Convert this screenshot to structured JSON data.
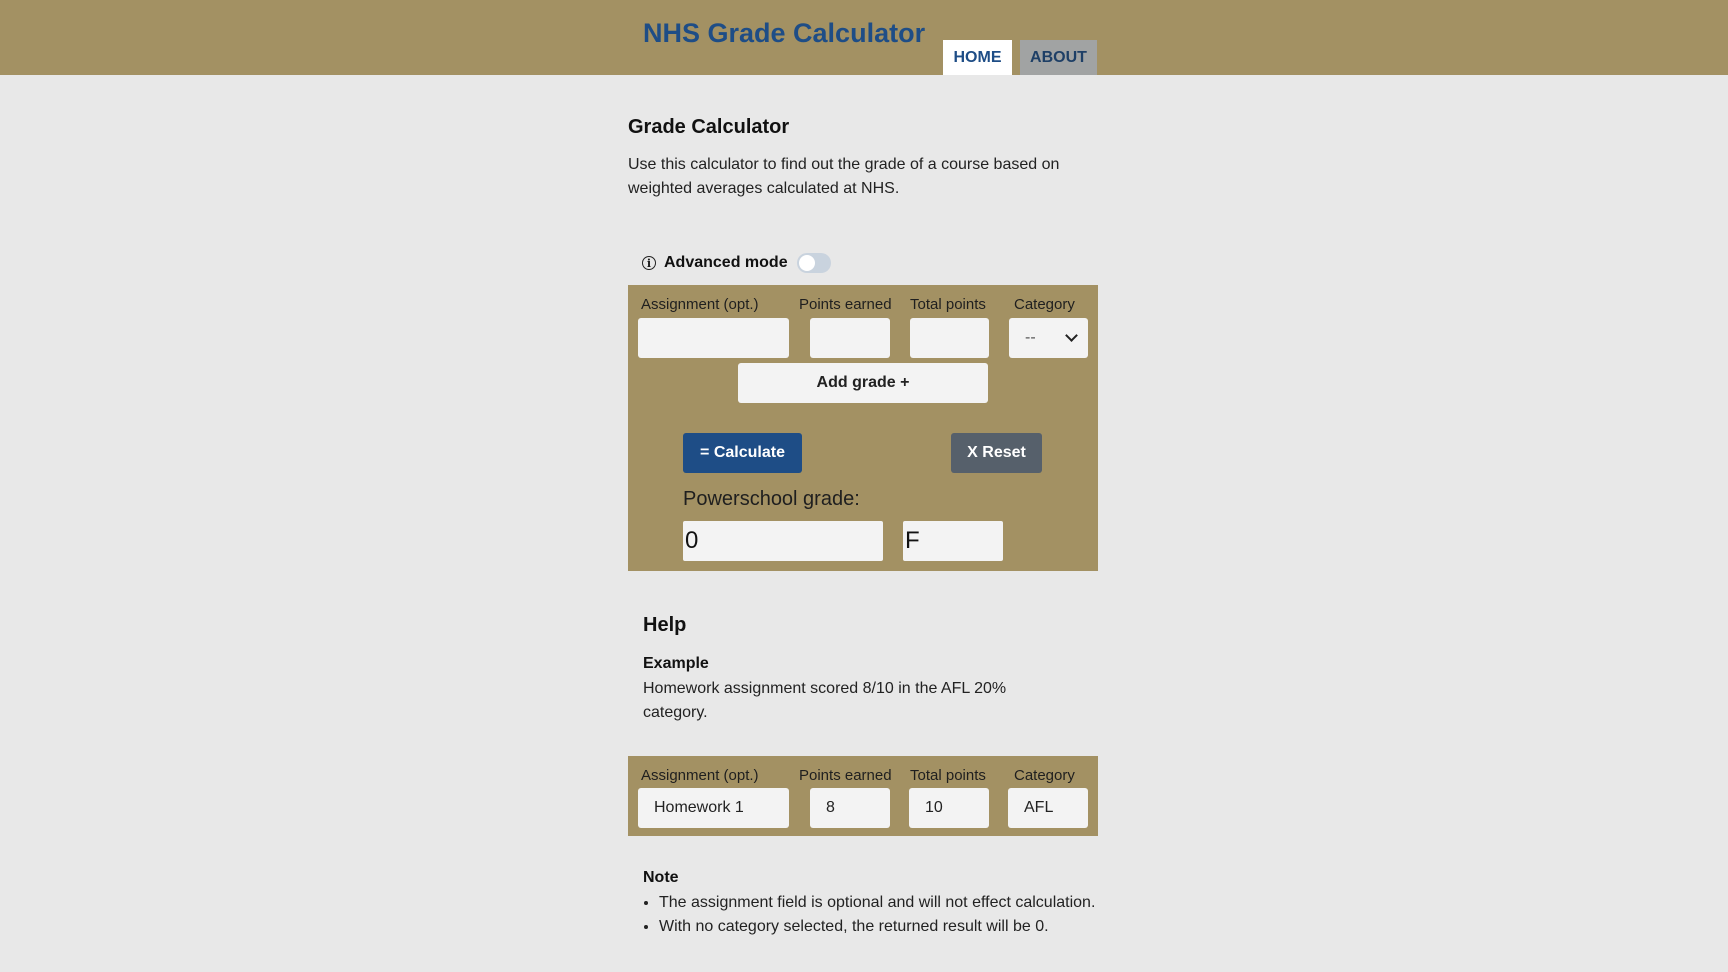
{
  "header": {
    "title": "NHS Grade Calculator",
    "tabs": [
      {
        "label": "HOME"
      },
      {
        "label": "ABOUT"
      }
    ]
  },
  "calculator": {
    "heading": "Grade Calculator",
    "intro": "Use this calculator to find out the grade of a course based on weighted averages calculated at NHS.",
    "advanced_mode": {
      "label": "Advanced mode",
      "enabled": false
    },
    "columns": {
      "assignment": "Assignment (opt.)",
      "points_earned": "Points earned",
      "total_points": "Total points",
      "category": "Category"
    },
    "inputs": {
      "assignment": "",
      "points_earned": "",
      "total_points": "",
      "category": "--"
    },
    "add_grade_label": "Add grade +",
    "calculate_label": "= Calculate",
    "reset_label": "X Reset",
    "powerschool_label": "Powerschool grade:",
    "grade_number": "0",
    "grade_letter": "F"
  },
  "help": {
    "heading": "Help",
    "example_heading": "Example",
    "example_text": "Homework assignment scored 8/10 in the AFL 20% category.",
    "example_columns": {
      "assignment": "Assignment (opt.)",
      "points_earned": "Points earned",
      "total_points": "Total points",
      "category": "Category"
    },
    "example_values": {
      "assignment": "Homework 1",
      "points_earned": "8",
      "total_points": "10",
      "category": "AFL"
    },
    "note_heading": "Note",
    "notes": [
      "The assignment field is optional and will not effect calculation.",
      "With no category selected, the returned result will be 0."
    ]
  },
  "colors": {
    "header_bg": "#a39163",
    "brand_blue": "#1e4d86",
    "reset_gray": "#56606b",
    "page_bg": "#e8e8e8"
  }
}
